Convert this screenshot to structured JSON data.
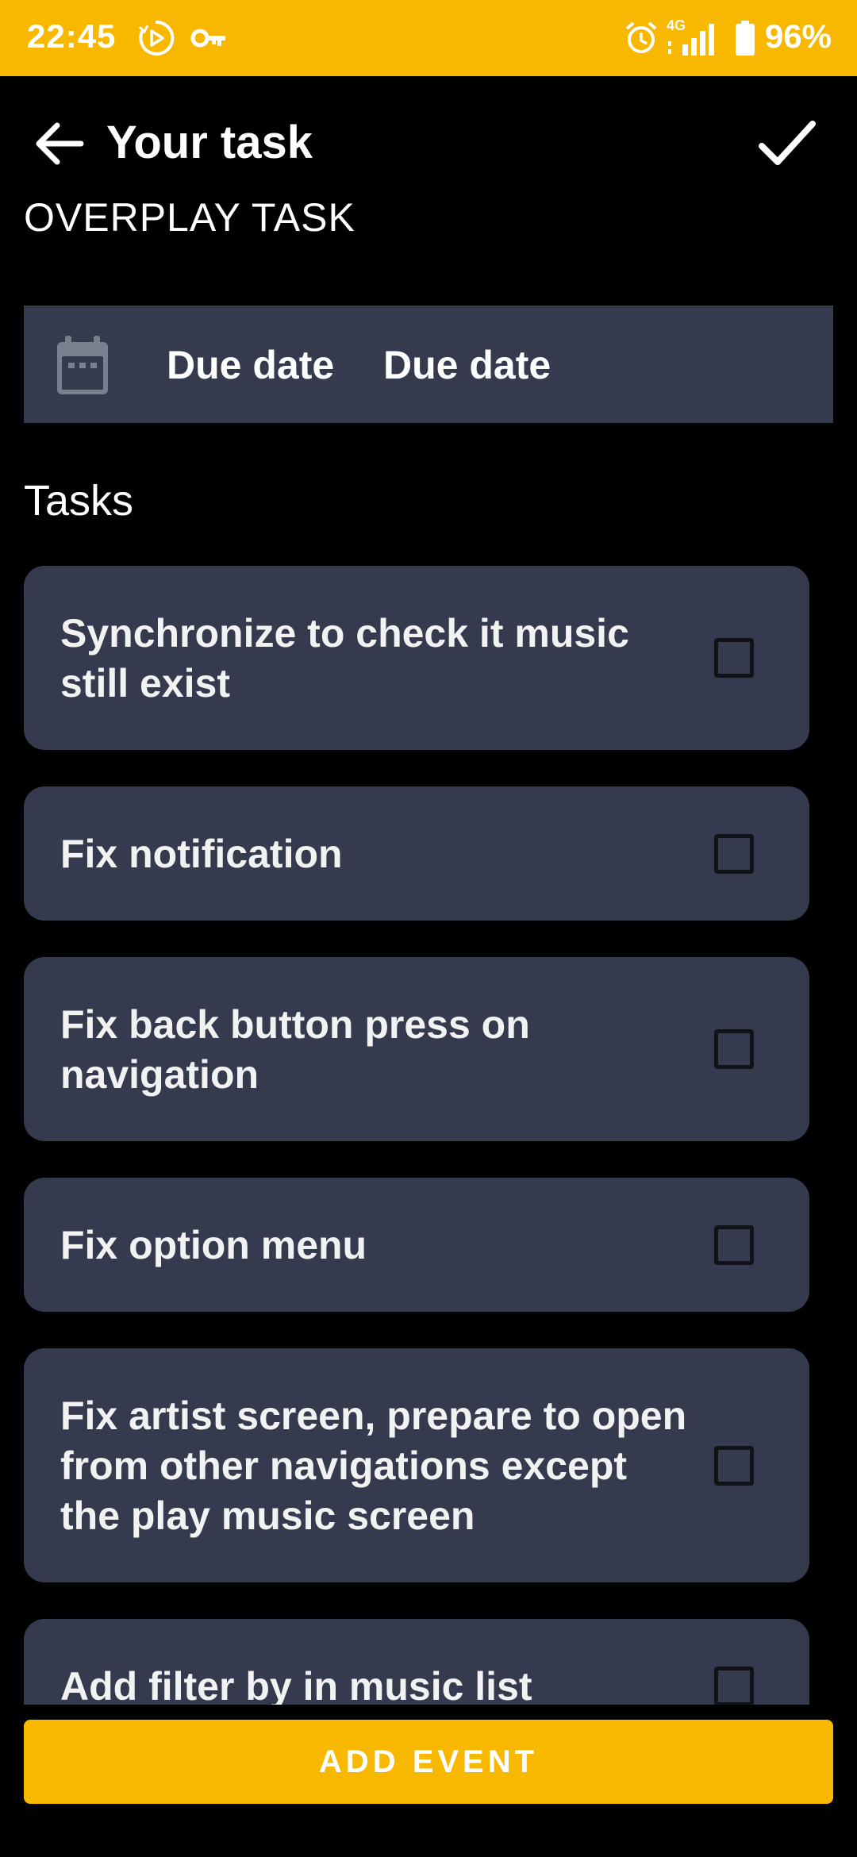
{
  "status_bar": {
    "time": "22:45",
    "battery": "96%",
    "network": "4G",
    "icons": [
      "play-circle-icon",
      "key-icon",
      "alarm-icon",
      "signal-icon",
      "battery-icon"
    ],
    "background": "#F9B800"
  },
  "app_bar": {
    "title": "Your task",
    "back_icon": "arrow-back-icon",
    "confirm_icon": "check-icon"
  },
  "section_heading": "OVERPLAY TASK",
  "due": {
    "icon": "calendar-icon",
    "label": "Due date",
    "value": "Due date"
  },
  "tasks_label": "Tasks",
  "tasks": [
    {
      "text": "Synchronize to check it music still exist",
      "checked": false
    },
    {
      "text": "Fix notification",
      "checked": false
    },
    {
      "text": "Fix back button press on navigation",
      "checked": false
    },
    {
      "text": "Fix option menu",
      "checked": false
    },
    {
      "text": "Fix artist screen, prepare to open from other navigations except the play music screen",
      "checked": false
    },
    {
      "text": "Add filter by in music list",
      "checked": false
    }
  ],
  "add_button": "ADD EVENT",
  "colors": {
    "accent": "#F9B800",
    "card": "#363A4F",
    "background": "#000000"
  }
}
